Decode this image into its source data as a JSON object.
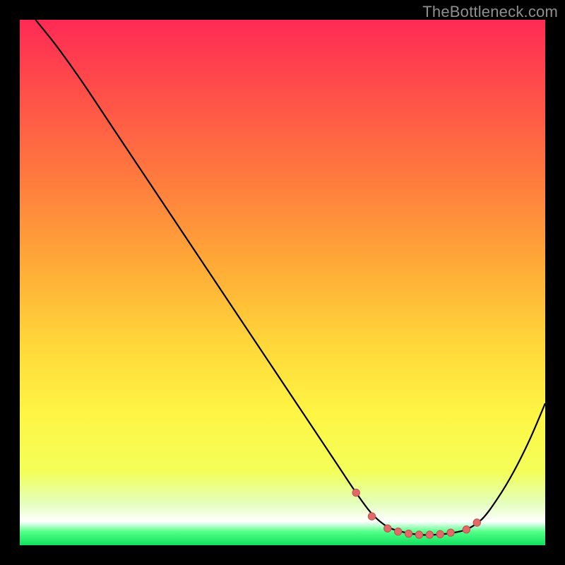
{
  "watermark": "TheBottleneck.com",
  "colors": {
    "page_bg": "#000000",
    "curve": "#000000",
    "marker_fill": "#e06a6a",
    "marker_stroke": "#c24f4f",
    "gradient_stops": [
      {
        "offset": 0.0,
        "color": "#ff2a55"
      },
      {
        "offset": 0.12,
        "color": "#ff4a4a"
      },
      {
        "offset": 0.3,
        "color": "#ff7a3e"
      },
      {
        "offset": 0.48,
        "color": "#ffae37"
      },
      {
        "offset": 0.62,
        "color": "#ffd83a"
      },
      {
        "offset": 0.75,
        "color": "#fff544"
      },
      {
        "offset": 0.86,
        "color": "#f3ff59"
      },
      {
        "offset": 0.92,
        "color": "#e4ffbc"
      },
      {
        "offset": 0.955,
        "color": "#ffffff"
      },
      {
        "offset": 0.975,
        "color": "#4fff85"
      },
      {
        "offset": 1.0,
        "color": "#11e060"
      }
    ]
  },
  "chart_data": {
    "type": "line",
    "title": "",
    "xlabel": "",
    "ylabel": "",
    "xlim": [
      0,
      100
    ],
    "ylim": [
      0,
      100
    ],
    "grid": false,
    "legend": false,
    "series": [
      {
        "name": "bottleneck-curve",
        "x": [
          3,
          7,
          12,
          18,
          24,
          30,
          36,
          42,
          48,
          54,
          60,
          64,
          67,
          70,
          73,
          76,
          79,
          82,
          85,
          88,
          91,
          94,
          97,
          100
        ],
        "y": [
          100,
          95,
          88,
          79,
          70,
          61,
          52,
          43,
          34,
          25,
          16,
          10,
          6,
          3.5,
          2.5,
          2,
          2,
          2.3,
          3,
          5,
          9,
          14,
          20,
          27
        ]
      }
    ],
    "markers": {
      "name": "optimal-range-markers",
      "x": [
        64,
        67,
        70,
        72,
        74,
        76,
        78,
        80,
        82,
        85,
        87
      ],
      "y": [
        10,
        5.5,
        3.2,
        2.6,
        2.2,
        2.0,
        2.0,
        2.1,
        2.4,
        3.0,
        4.3
      ]
    }
  }
}
